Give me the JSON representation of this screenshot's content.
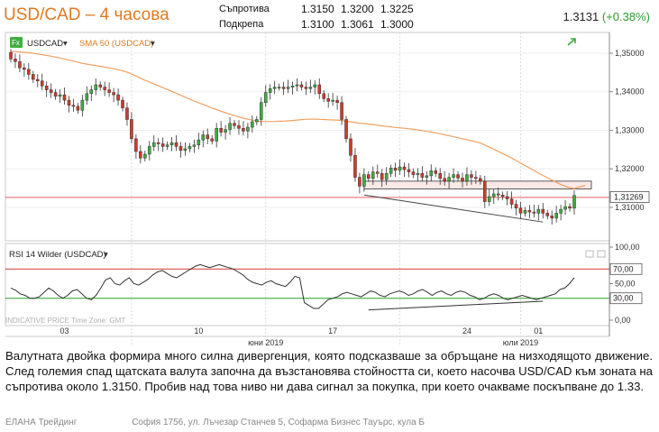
{
  "title": "USD/CAD – 4 часова",
  "levels": {
    "resistance_label": "Съпротива",
    "resistance_values": [
      "1.3150",
      "1.3200",
      "1.3225"
    ],
    "support_label": "Подкрепа",
    "support_values": [
      "1.3100",
      "1.3061",
      "1.3000"
    ]
  },
  "quote": {
    "price": "1.3131",
    "change": "(+0.38%)"
  },
  "legend": {
    "fx_badge": "Fx",
    "symbol": "USDCAD",
    "sma_label": "SMA 50 (USDCAD)"
  },
  "rsi_panel": {
    "title": "RSI 14 Wilder (USDCAD)",
    "watermark": "INDICATIVE PRICE   Time Zone: GMT"
  },
  "colors": {
    "title": "#e07a1f",
    "up_candle": "#3fae3f",
    "down_candle": "#d23a2a",
    "sma": "#f0a060",
    "resistance_line": "#e06060",
    "rsi_upper": "#d23a2a",
    "rsi_lower": "#2a9d2a",
    "change": "#2a9d2a"
  },
  "chart_data": [
    {
      "type": "candlestick",
      "symbol": "USDCAD",
      "timeframe": "4 часова",
      "ylim": [
        1.3025,
        1.3535
      ],
      "y_ticks": [
        "1,35000",
        "1,34000",
        "1,33000",
        "1,32000",
        "1,31000"
      ],
      "y_tick_values": [
        1.35,
        1.34,
        1.33,
        1.32,
        1.31
      ],
      "x_tick_labels": [
        "03",
        "10",
        "17",
        "24",
        "01"
      ],
      "x_month_labels": [
        "юни 2019",
        "юли 2019"
      ],
      "last_price_label": "1,31269",
      "last_price": 1.31269,
      "close": [
        1.3485,
        1.3478,
        1.3462,
        1.3458,
        1.3445,
        1.3432,
        1.3428,
        1.3415,
        1.3405,
        1.3398,
        1.3388,
        1.3392,
        1.3378,
        1.3365,
        1.3362,
        1.3352,
        1.3378,
        1.3395,
        1.3405,
        1.3418,
        1.3412,
        1.3405,
        1.3398,
        1.3392,
        1.3378,
        1.3358,
        1.3328,
        1.3278,
        1.3245,
        1.3228,
        1.3238,
        1.3258,
        1.3268,
        1.3265,
        1.3258,
        1.3262,
        1.3268,
        1.3258,
        1.3248,
        1.3252,
        1.3258,
        1.3262,
        1.3275,
        1.3288,
        1.3278,
        1.3272,
        1.3305,
        1.3295,
        1.3302,
        1.3318,
        1.3312,
        1.3305,
        1.3298,
        1.3308,
        1.3322,
        1.3328,
        1.3372,
        1.3398,
        1.3408,
        1.3412,
        1.3412,
        1.3408,
        1.3412,
        1.3415,
        1.3418,
        1.3412,
        1.3408,
        1.3412,
        1.3418,
        1.3395,
        1.3382,
        1.3375,
        1.3378,
        1.3372,
        1.3328,
        1.3278,
        1.3235,
        1.3178,
        1.3155,
        1.3185,
        1.3175,
        1.3192,
        1.3188,
        1.3172,
        1.3188,
        1.3202,
        1.3196,
        1.3205,
        1.3198,
        1.3192,
        1.3185,
        1.3188,
        1.3178,
        1.3182,
        1.3195,
        1.3188,
        1.3175,
        1.3168,
        1.3178,
        1.3185,
        1.3176,
        1.3168,
        1.3185,
        1.3178,
        1.3175,
        1.3168,
        1.3115,
        1.3128,
        1.3135,
        1.3132,
        1.3128,
        1.3122,
        1.3108,
        1.3098,
        1.3085,
        1.3092,
        1.3088,
        1.3085,
        1.3095,
        1.3085,
        1.3078,
        1.3072,
        1.3085,
        1.3095,
        1.3102,
        1.3098,
        1.3131
      ],
      "rsi": {
        "ylim": [
          0,
          100
        ],
        "y_ticks": [
          "100,00",
          "50,00",
          "0,00"
        ],
        "y_tick_values": [
          100,
          50,
          0
        ],
        "levels": [
          70,
          30
        ],
        "level_labels": [
          "70,00",
          "30,00"
        ],
        "values": [
          44,
          41,
          36,
          34,
          30,
          30,
          32,
          38,
          44,
          40,
          34,
          30,
          34,
          40,
          42,
          36,
          30,
          28,
          34,
          44,
          55,
          58,
          50,
          48,
          54,
          58,
          50,
          48,
          52,
          56,
          62,
          66,
          68,
          64,
          60,
          58,
          62,
          66,
          70,
          74,
          76,
          74,
          72,
          74,
          76,
          74,
          72,
          70,
          66,
          62,
          56,
          52,
          50,
          48,
          52,
          54,
          50,
          48,
          46,
          52,
          60,
          58,
          24,
          20,
          16,
          16,
          22,
          28,
          30,
          32,
          36,
          38,
          36,
          34,
          32,
          36,
          40,
          38,
          34,
          32,
          36,
          38,
          40,
          38,
          34,
          36,
          40,
          42,
          38,
          34,
          38,
          40,
          36,
          34,
          38,
          40,
          38,
          34,
          32,
          28,
          30,
          34,
          36,
          34,
          30,
          28,
          30,
          32,
          34,
          32,
          30,
          28,
          30,
          32,
          34,
          36,
          42,
          44,
          50,
          58
        ]
      }
    }
  ],
  "description": "Валутната двойка формира много силна дивергенция, която подсказваше за обръщане на низходящото движение. След големия спад щатската валута започна да възстановява стойността си, което насочва USD/CAD към зоната на съпротива около 1.3150. Пробив над това ниво ни дава сигнал за покупка, при което очакваме поскъпване до 1.33.",
  "footer": {
    "company": "ЕЛАНА Трейдинг",
    "address": "София 1756, ул. Лъчезар Станчев 5, Софарма Бизнес Тауърс, кула Б"
  }
}
